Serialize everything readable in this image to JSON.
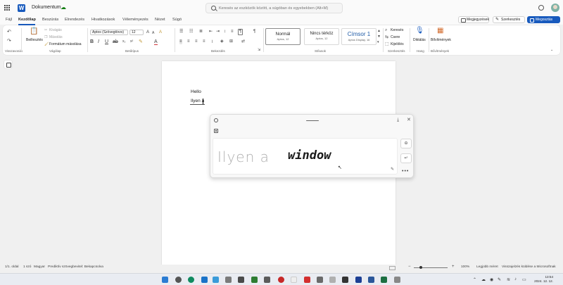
{
  "title_bar": {
    "doc_name": "Dokumentum",
    "search_placeholder": "Keresés az eszközök között, a súgóban és egyebekben (Alt+M)"
  },
  "tabs": [
    {
      "label": "Fájl"
    },
    {
      "label": "Kezdőlap",
      "active": true
    },
    {
      "label": "Beszúrás"
    },
    {
      "label": "Elrendezés"
    },
    {
      "label": "Hivatkozások"
    },
    {
      "label": "Véleményezés"
    },
    {
      "label": "Nézet"
    },
    {
      "label": "Súgó"
    }
  ],
  "actions": {
    "comments": "Megjegyzések",
    "editing": "Szerkesztés",
    "share": "Megosztás"
  },
  "ribbon": {
    "groups": {
      "undo": "Visszavonás",
      "clipboard": "Vágólap",
      "font": "Betűtípus",
      "paragraph": "Bekezdés",
      "styles": "Stílusok",
      "editing": "Szerkesztés",
      "voice": "Hang",
      "addins": "Bővítmények"
    },
    "paste_label": "Beillesztés",
    "cut_label": "Kivágás",
    "copy_label": "Másolás",
    "format_painter_label": "Formátum másolása",
    "font_name": "Aptos (Szövegtörzs)",
    "font_size": "12",
    "styles": [
      {
        "name": "Normál",
        "sub": "Aptos, 12"
      },
      {
        "name": "Nincs térköz",
        "sub": "Aptos, 12"
      },
      {
        "name": "Címsor 1",
        "sub": "Aptos Display, 16"
      }
    ],
    "find_label": "Keresés",
    "replace_label": "Csere",
    "select_label": "Kijelölés",
    "dictate_label": "Diktálás",
    "addins_label": "Bővítmények"
  },
  "document": {
    "line1": "Hello",
    "line2": "Ilyen a"
  },
  "handwriting_panel": {
    "recognized_text": "Ilyen a",
    "ink_text": "window"
  },
  "status_bar": {
    "page": "1/1. oldal",
    "words": "1 szó",
    "language": "Magyar",
    "prediction": "Prediktív szövegbevitel: Bekapcsolva",
    "zoom": "100%",
    "fit": "Legjobb méret",
    "feedback": "Visszajelzés küldése a Microsoftnak"
  },
  "taskbar": {
    "time": "13:54",
    "date": "2024. 12. 12."
  },
  "colors": {
    "accent": "#185abd",
    "font_color_underline": "#d13438"
  }
}
